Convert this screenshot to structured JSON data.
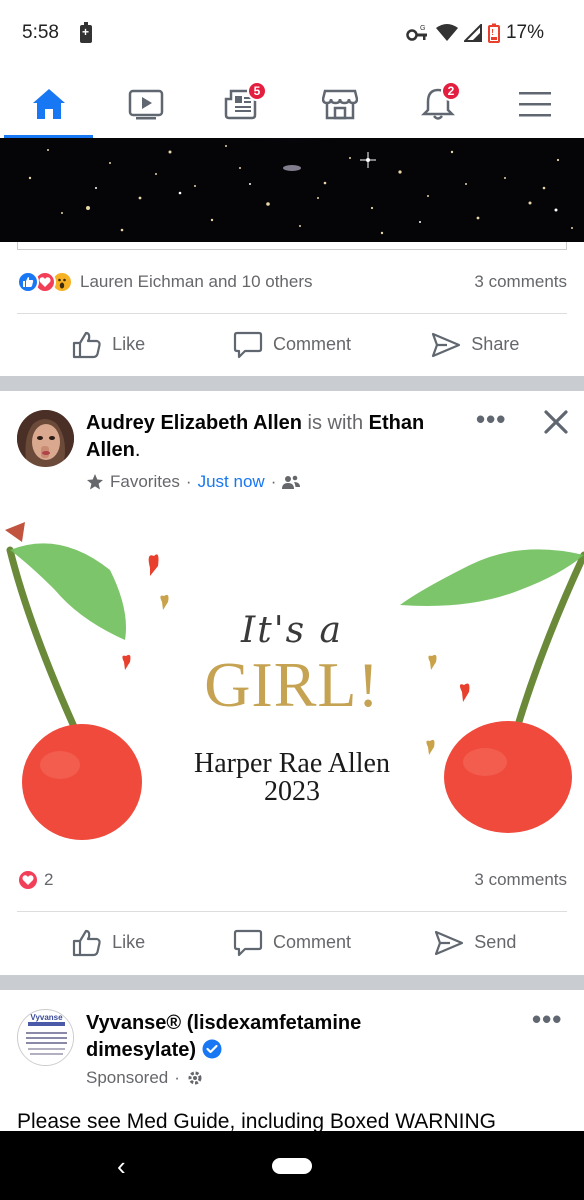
{
  "status_bar": {
    "time": "5:58",
    "battery": "17%"
  },
  "nav": {
    "items": [
      {
        "name": "home",
        "active": true,
        "badge": ""
      },
      {
        "name": "watch",
        "active": false,
        "badge": ""
      },
      {
        "name": "news",
        "active": false,
        "badge": "5"
      },
      {
        "name": "marketplace",
        "active": false,
        "badge": ""
      },
      {
        "name": "notifications",
        "active": false,
        "badge": "2"
      },
      {
        "name": "menu",
        "active": false,
        "badge": ""
      }
    ]
  },
  "colors": {
    "accent": "#1877f2",
    "badge": "#e41e3f",
    "muted": "#65676b",
    "separator": "#c9ccd1",
    "gold": "#c6a353",
    "cherry": "#ef4a3c"
  },
  "post1": {
    "reactors": "Lauren Eichman and 10 others",
    "comments": "3 comments",
    "actions": {
      "like": "Like",
      "comment": "Comment",
      "share": "Share"
    }
  },
  "post2": {
    "author": "Audrey Elizabeth Allen",
    "with_text": "is with",
    "tagged_first": "Ethan",
    "tagged_last": "Allen",
    "period": ".",
    "audience": "Favorites",
    "time": "Just now",
    "dot": "·",
    "image_text": {
      "its": "It's a",
      "girl": "GIRL!",
      "name": "Harper Rae Allen",
      "year": "2023"
    },
    "reaction_count": "2",
    "comments": "3 comments",
    "actions": {
      "like": "Like",
      "comment": "Comment",
      "send": "Send"
    }
  },
  "post3": {
    "author_line1": "Vyvanse® (lisdexamfetamine",
    "author_line2": "dimesylate)",
    "sponsored": "Sponsored",
    "avatar_text": "Vyvanse",
    "body": "Please see Med Guide, including Boxed WARNING"
  }
}
